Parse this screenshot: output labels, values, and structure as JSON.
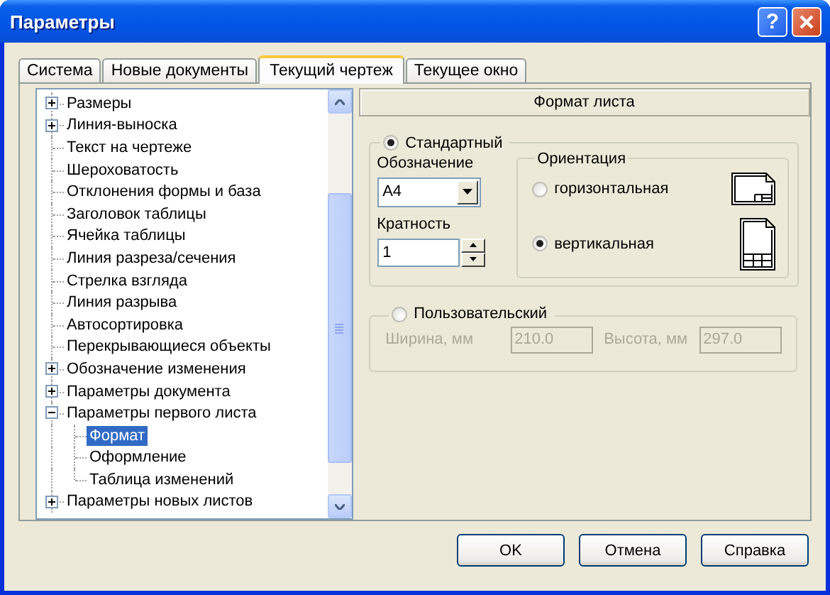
{
  "window": {
    "title": "Параметры",
    "help_button": "?"
  },
  "tabs": [
    {
      "label": "Система",
      "selected": false
    },
    {
      "label": "Новые документы",
      "selected": false
    },
    {
      "label": "Текущий чертеж",
      "selected": true
    },
    {
      "label": "Текущее окно",
      "selected": false
    }
  ],
  "tree": {
    "items": [
      {
        "label": "Размеры",
        "expanded": false,
        "selected": false
      },
      {
        "label": "Линия-выноска",
        "expanded": false,
        "selected": false
      },
      {
        "label": "Текст на чертеже",
        "selected": false
      },
      {
        "label": "Шероховатость",
        "selected": false
      },
      {
        "label": "Отклонения формы и база",
        "selected": false
      },
      {
        "label": "Заголовок таблицы",
        "selected": false
      },
      {
        "label": "Ячейка таблицы",
        "selected": false
      },
      {
        "label": "Линия разреза/сечения",
        "selected": false
      },
      {
        "label": "Стрелка взгляда",
        "selected": false
      },
      {
        "label": "Линия разрыва",
        "selected": false
      },
      {
        "label": "Автосортировка",
        "selected": false
      },
      {
        "label": "Перекрывающиеся объекты",
        "selected": false
      },
      {
        "label": "Обозначение изменения",
        "expanded": false,
        "selected": false
      },
      {
        "label": "Параметры документа",
        "expanded": false,
        "selected": false
      },
      {
        "label": "Параметры первого листа",
        "expanded": true,
        "selected": false,
        "children": [
          {
            "label": "Формат",
            "selected": true
          },
          {
            "label": "Оформление",
            "selected": false
          },
          {
            "label": "Таблица изменений",
            "selected": false
          }
        ]
      },
      {
        "label": "Параметры новых листов",
        "expanded": false,
        "selected": false
      }
    ]
  },
  "format": {
    "header": "Формат листа",
    "standard": {
      "label": "Стандартный",
      "selected": true,
      "designation_label": "Обозначение",
      "designation_value": "A4",
      "multiplicity_label": "Кратность",
      "multiplicity_value": "1",
      "orientation": {
        "title": "Ориентация",
        "options": [
          {
            "label": "горизонтальная",
            "selected": false,
            "kind": "landscape"
          },
          {
            "label": "вертикальная",
            "selected": true,
            "kind": "portrait"
          }
        ]
      }
    },
    "custom": {
      "label": "Пользовательский",
      "selected": false,
      "disabled": true,
      "width_label": "Ширина, мм",
      "width_value": "210.0",
      "height_label": "Высота, мм",
      "height_value": "297.0"
    }
  },
  "buttons": [
    "OK",
    "Отмена",
    "Справка"
  ]
}
